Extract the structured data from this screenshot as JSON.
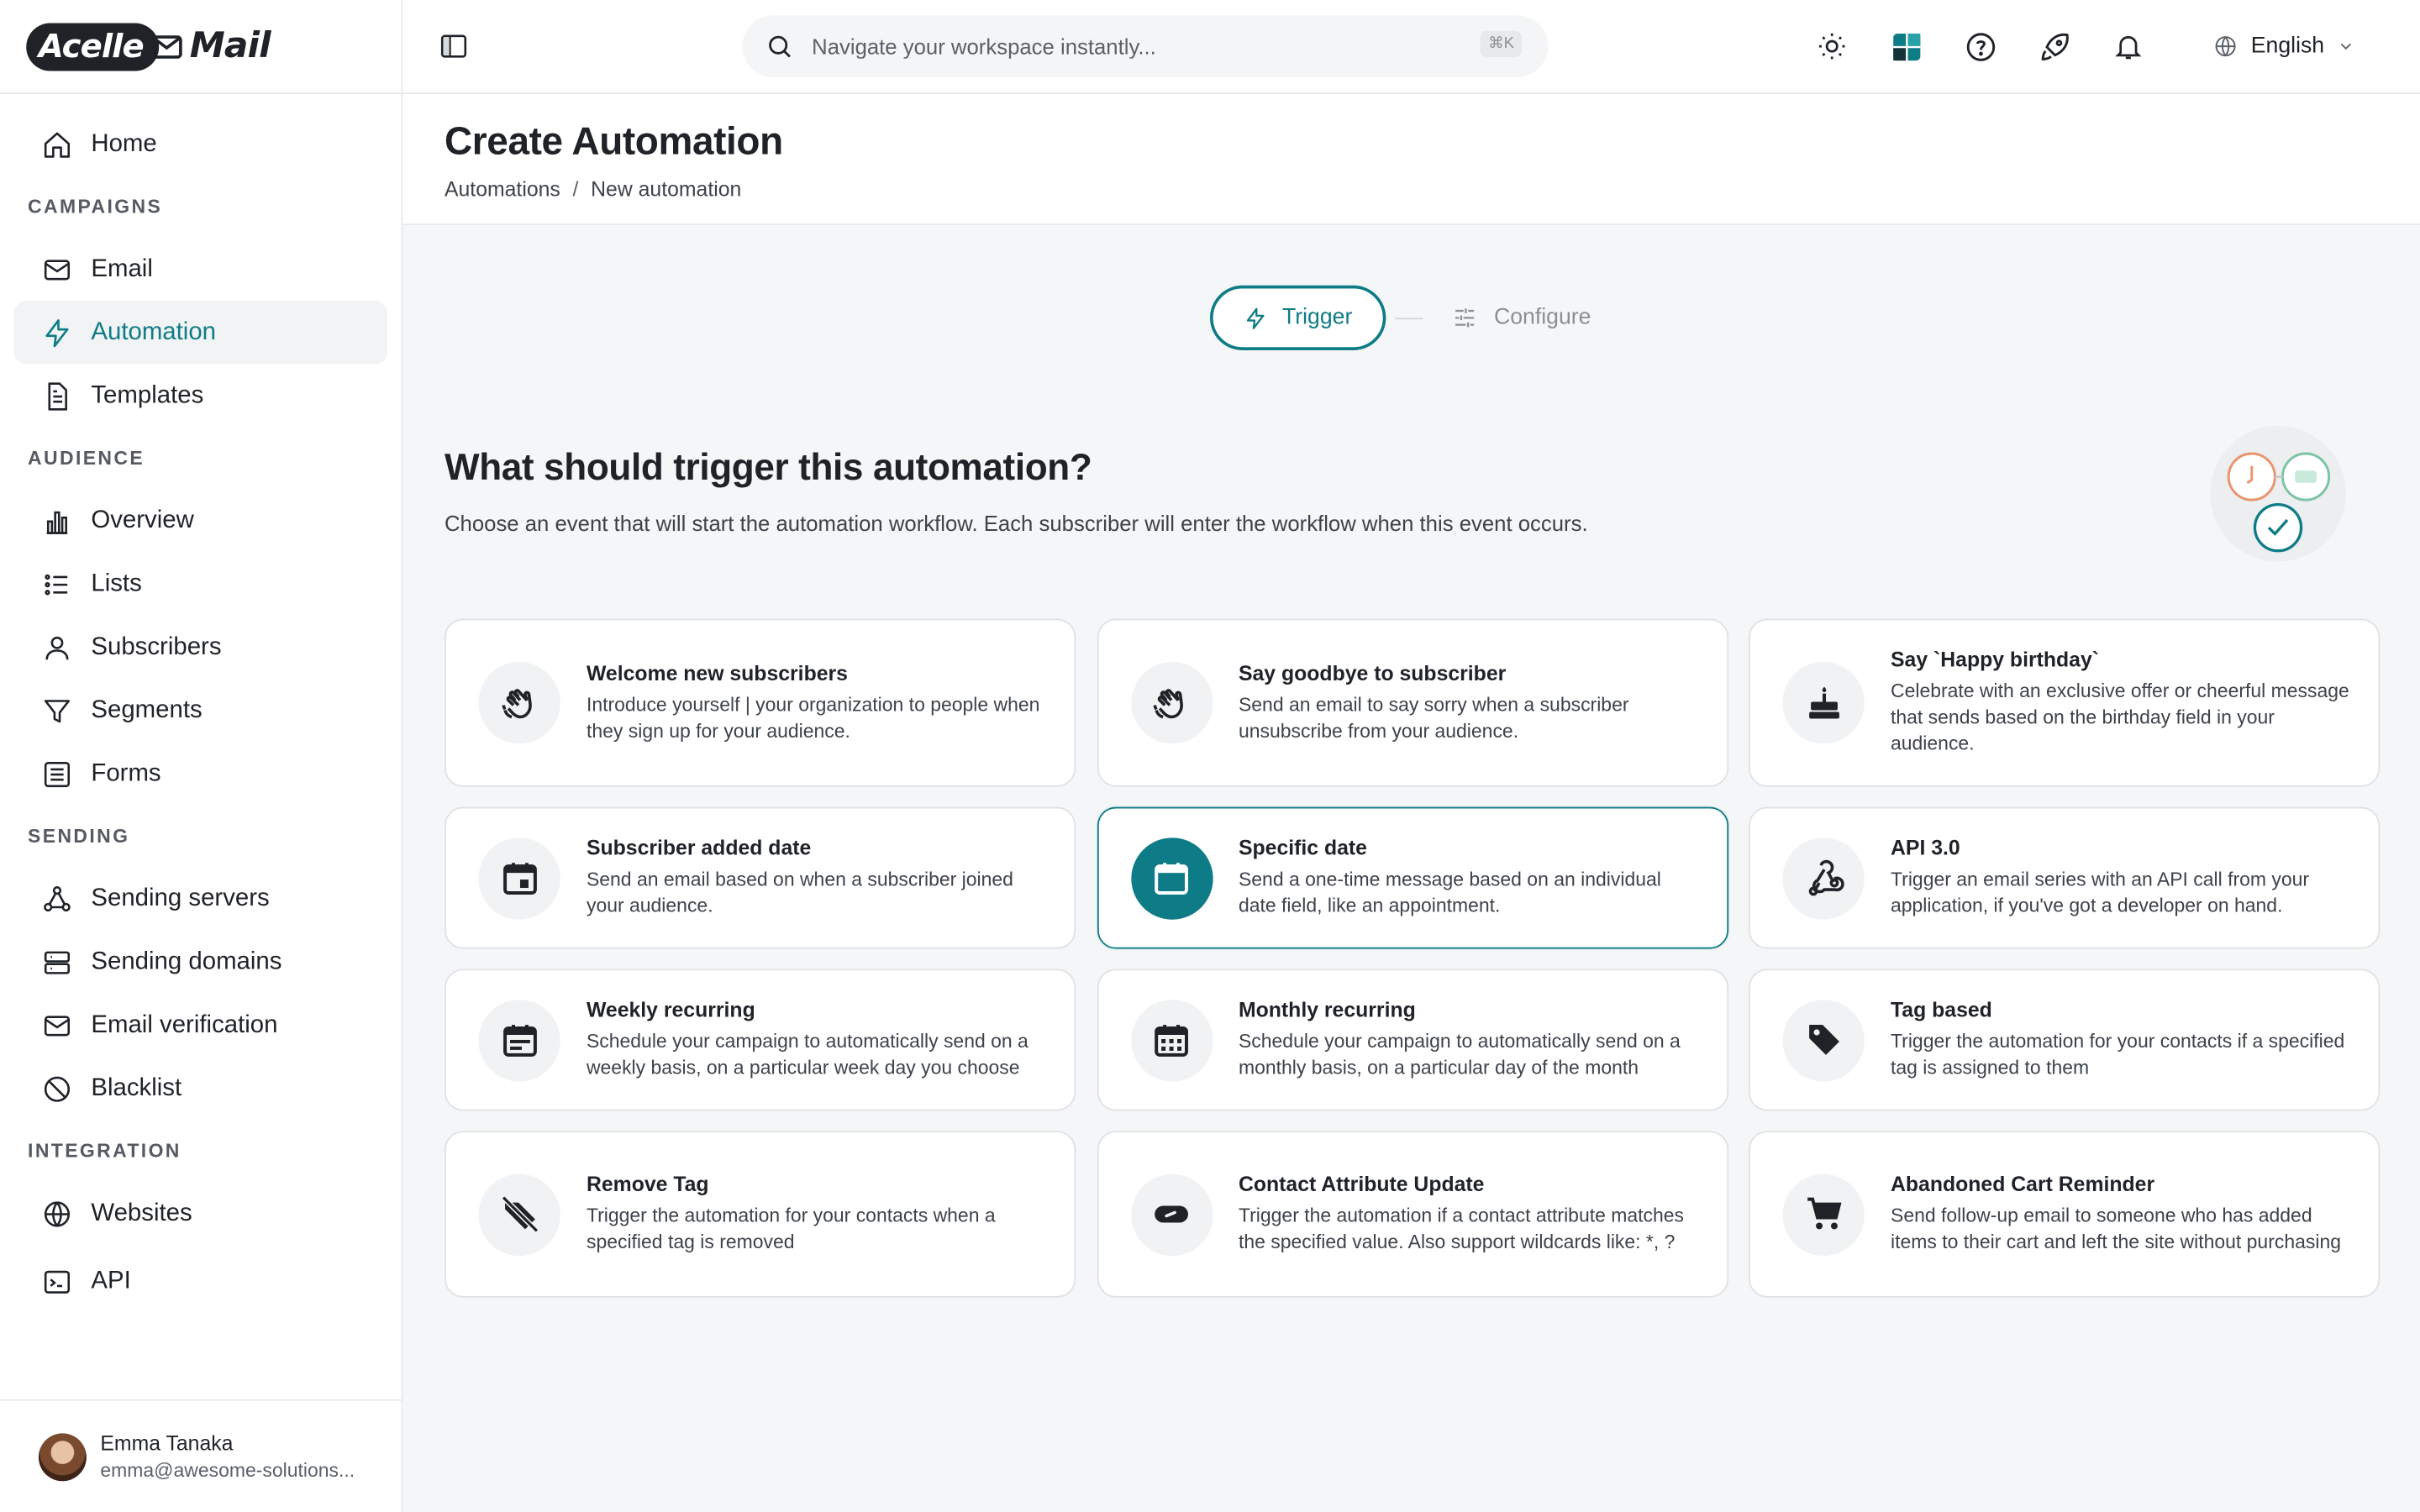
{
  "brand": {
    "logo_left": "Acelle",
    "logo_right": "Mail"
  },
  "search": {
    "placeholder": "Navigate your workspace instantly...",
    "shortcut": "⌘K"
  },
  "topbar": {
    "language": "English"
  },
  "sidebar": {
    "home": "Home",
    "sections": {
      "campaigns": "CAMPAIGNS",
      "audience": "AUDIENCE",
      "sending": "SENDING",
      "integration": "INTEGRATION"
    },
    "campaigns": [
      "Email",
      "Automation",
      "Templates"
    ],
    "audience": [
      "Overview",
      "Lists",
      "Subscribers",
      "Segments",
      "Forms"
    ],
    "sending": [
      "Sending servers",
      "Sending domains",
      "Email verification",
      "Blacklist"
    ],
    "integration": [
      "Websites",
      "API"
    ]
  },
  "user": {
    "name": "Emma Tanaka",
    "email": "emma@awesome-solutions..."
  },
  "page": {
    "title": "Create Automation",
    "breadcrumb": [
      "Automations",
      "/",
      "New automation"
    ]
  },
  "stepper": {
    "active": "Trigger",
    "next": "Configure"
  },
  "question": {
    "title": "What should trigger this automation?",
    "description": "Choose an event that will start the automation workflow. Each subscriber will enter the workflow when this event occurs."
  },
  "triggers": [
    {
      "title": "Welcome new subscribers",
      "desc": "Introduce yourself | your organization to people when they sign up for your audience.",
      "icon": "wave-hand-icon"
    },
    {
      "title": "Say goodbye to subscriber",
      "desc": "Send an email to say sorry when a subscriber unsubscribe from your audience.",
      "icon": "wave-hand-icon"
    },
    {
      "title": "Say `Happy birthday`",
      "desc": "Celebrate with an exclusive offer or cheerful message that sends based on the birthday field in your audience.",
      "icon": "cake-icon"
    },
    {
      "title": "Subscriber added date",
      "desc": "Send an email based on when a subscriber joined your audience.",
      "icon": "calendar-event-icon"
    },
    {
      "title": "Specific date",
      "desc": "Send a one-time message based on an individual date field, like an appointment.",
      "icon": "calendar-icon",
      "selected": true
    },
    {
      "title": "API 3.0",
      "desc": "Trigger an email series with an API call from your application, if you've got a developer on hand.",
      "icon": "webhook-icon"
    },
    {
      "title": "Weekly recurring",
      "desc": "Schedule your campaign to automatically send on a weekly basis, on a particular week day you choose",
      "icon": "calendar-week-icon"
    },
    {
      "title": "Monthly recurring",
      "desc": "Schedule your campaign to automatically send on a monthly basis, on a particular day of the month",
      "icon": "calendar-month-icon"
    },
    {
      "title": "Tag based",
      "desc": "Trigger the automation for your contacts if a specified tag is assigned to them",
      "icon": "tag-icon"
    },
    {
      "title": "Remove Tag",
      "desc": "Trigger the automation for your contacts when a specified tag is removed",
      "icon": "tag-off-icon"
    },
    {
      "title": "Contact Attribute Update",
      "desc": "Trigger the automation if a contact attribute matches the specified value. Also support wildcards like: *, ?",
      "icon": "toggle-icon"
    },
    {
      "title": "Abandoned Cart Reminder",
      "desc": "Send follow-up email to someone who has added items to their cart and left the site without purchasing",
      "icon": "cart-icon"
    }
  ],
  "colors": {
    "accent": "#0e7c86",
    "background": "#f5f6f7"
  }
}
